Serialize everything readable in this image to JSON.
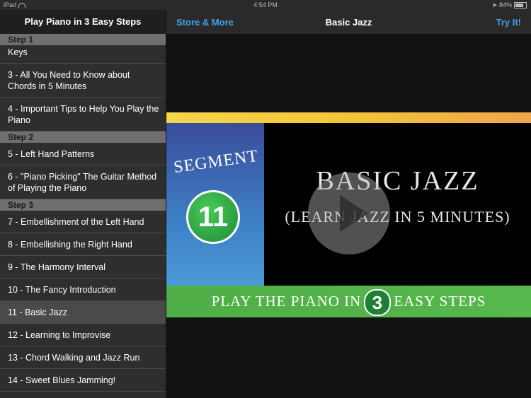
{
  "status": {
    "device": "iPad",
    "time": "4:54 PM",
    "battery": "84%"
  },
  "sidebar": {
    "title": "Play Piano in 3 Easy Steps",
    "sections": [
      {
        "label": "Step 1",
        "items": [
          {
            "label": "Keys"
          },
          {
            "label": "3 - All You Need to Know about Chords in 5 Minutes"
          },
          {
            "label": "4 - Important Tips to Help You Play the Piano"
          }
        ]
      },
      {
        "label": "Step 2",
        "items": [
          {
            "label": "5 - Left Hand Patterns"
          },
          {
            "label": "6 - \"Piano Picking\" The Guitar Method of Playing the Piano"
          }
        ]
      },
      {
        "label": "Step 3",
        "items": [
          {
            "label": "7 - Embellishment of the Left Hand"
          },
          {
            "label": "8 - Embellishing the Right Hand"
          },
          {
            "label": "9 - The Harmony Interval"
          },
          {
            "label": "10 - The Fancy Introduction"
          },
          {
            "label": "11 - Basic Jazz"
          },
          {
            "label": "12 - Learning to Improvise"
          },
          {
            "label": "13 - Chord Walking and Jazz Run"
          },
          {
            "label": "14 - Sweet Blues Jamming!"
          }
        ]
      }
    ]
  },
  "nav": {
    "left": "Store & More",
    "title": "Basic Jazz",
    "right": "Try It!"
  },
  "video": {
    "segment_label": "SEGMENT",
    "segment_number": "11",
    "title": "BASIC JAZZ",
    "subtitle": "(LEARN JAZZ IN 5 MINUTES)",
    "banner_prefix": "PLAY THE PIANO IN",
    "banner_number": "3",
    "banner_suffix": "EASY STEPS"
  }
}
